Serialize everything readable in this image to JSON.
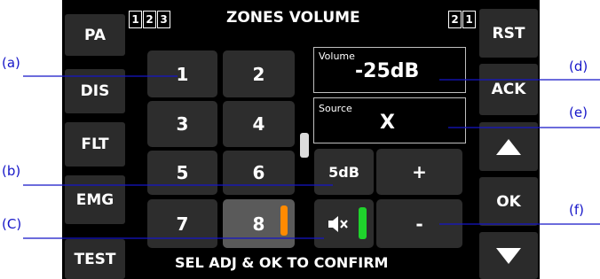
{
  "header": {
    "title": "ZONES VOLUME",
    "left_indicators": [
      "1",
      "2",
      "3"
    ],
    "right_indicators": [
      "2",
      "1"
    ]
  },
  "left_buttons": [
    "PA",
    "DIS",
    "FLT",
    "EMG",
    "TEST"
  ],
  "right_buttons": {
    "reset": "RST",
    "ack": "ACK",
    "ok": "OK"
  },
  "zone_buttons": [
    "1",
    "2",
    "3",
    "4",
    "5",
    "6",
    "7",
    "8"
  ],
  "selected_zone": "8",
  "volume": {
    "label": "Volume",
    "value": "-25dB"
  },
  "source": {
    "label": "Source",
    "value": "X"
  },
  "step_button": "5dB",
  "plus_button": "+",
  "minus_button": "-",
  "footer": "SEL ADJ & OK TO CONFIRM",
  "callouts": [
    "(a)",
    "(b)",
    "(C)",
    "(d)",
    "(e)",
    "(f)"
  ],
  "colors": {
    "zone8_indicator": "#ff8a00",
    "speaker_indicator": "#1fd32c",
    "callout": "#1515c8"
  }
}
